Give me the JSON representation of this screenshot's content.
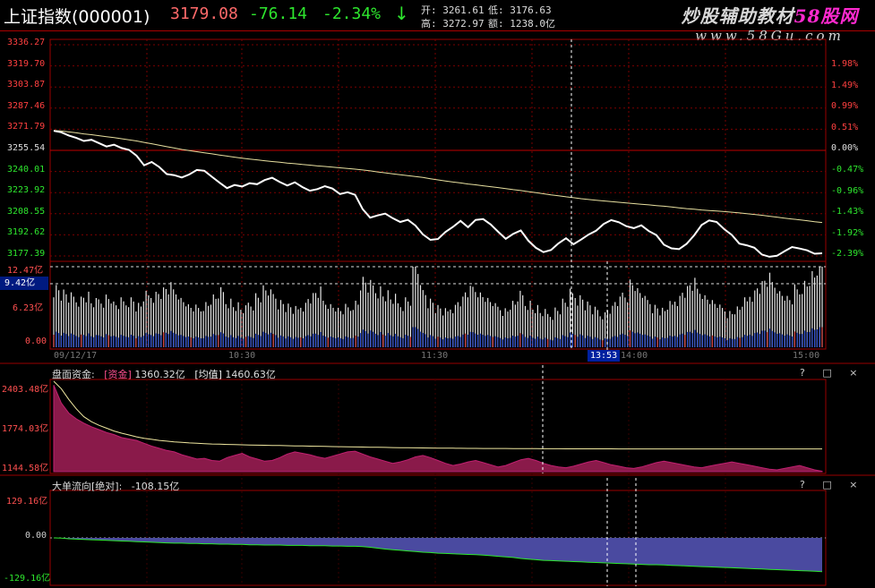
{
  "header": {
    "name": "上证指数(000001)",
    "price": "3179.08",
    "change": "-76.14",
    "pct": "-2.34%",
    "arrow": "↓",
    "open_label": "开:",
    "open": "3261.61",
    "low_label": "低:",
    "low": "3176.63",
    "high_label": "高:",
    "high": "3272.97",
    "amount_label": "额:",
    "amount": "1238.0亿"
  },
  "brand": {
    "title_a": "炒股辅助教材",
    "title_b": "58股网",
    "url": "www.58Gu.com"
  },
  "main": {
    "price_labels": [
      "3336.27",
      "3319.70",
      "3303.87",
      "3287.46",
      "3271.79",
      "3255.54",
      "3240.01",
      "3223.92",
      "3208.55",
      "3192.62",
      "3177.39"
    ],
    "pct_labels": [
      "1.98%",
      "1.49%",
      "0.99%",
      "0.51%",
      "0.00%",
      "-0.47%",
      "-0.96%",
      "-1.43%",
      "-1.92%",
      "-2.39%"
    ],
    "colors": {
      "up": "#ff4040",
      "down": "#2ee62e",
      "price_line": "#ffffff",
      "avg_line": "#e8e0a0",
      "grid": "#a00000"
    }
  },
  "volume": {
    "labels": [
      "12.47亿",
      "9.42亿",
      "6.23亿",
      "0.00"
    ],
    "time_labels": [
      "09/12/17",
      "10:30",
      "11:30",
      "14:00",
      "15:00"
    ],
    "cursor_time": "13:53"
  },
  "fund": {
    "title": "盘面资金:",
    "tag1": "[资金]",
    "val1": "1360.32亿",
    "tag2": "[均值]",
    "val2": "1460.63亿",
    "labels": [
      "2403.48亿",
      "1774.03亿",
      "1144.58亿"
    ],
    "controls": "? □ × "
  },
  "bigorder": {
    "title": "大单流向[绝对]:",
    "value": "-108.15亿",
    "labels": [
      "129.16亿",
      "0.00",
      "-129.16亿"
    ],
    "controls": "? □ × "
  },
  "series": {
    "price": [
      3271.5,
      3270.4,
      3268.0,
      3266.2,
      3263.9,
      3264.8,
      3262.3,
      3259.7,
      3261.1,
      3258.6,
      3257.2,
      3252.8,
      3245.6,
      3248.1,
      3244.3,
      3239.0,
      3238.2,
      3236.4,
      3238.7,
      3242.1,
      3241.5,
      3237.0,
      3232.5,
      3228.4,
      3230.8,
      3229.6,
      3232.1,
      3231.4,
      3234.5,
      3236.2,
      3233.0,
      3230.4,
      3232.8,
      3229.2,
      3226.5,
      3227.7,
      3229.9,
      3228.1,
      3224.0,
      3225.3,
      3223.4,
      3212.7,
      3206.2,
      3207.9,
      3209.2,
      3205.8,
      3203.0,
      3204.6,
      3200.3,
      3193.6,
      3189.5,
      3190.1,
      3195.4,
      3199.3,
      3203.8,
      3199.0,
      3204.5,
      3205.1,
      3201.1,
      3195.6,
      3190.3,
      3194.0,
      3196.6,
      3188.9,
      3183.5,
      3180.3,
      3181.8,
      3186.9,
      3190.7,
      3186.2,
      3189.7,
      3193.5,
      3196.4,
      3201.5,
      3204.4,
      3202.8,
      3199.8,
      3198.3,
      3200.4,
      3196.1,
      3193.1,
      3185.8,
      3183.1,
      3182.5,
      3186.5,
      3192.9,
      3200.7,
      3204.1,
      3203.0,
      3197.6,
      3193.2,
      3186.7,
      3185.4,
      3183.6,
      3178.5,
      3176.8,
      3177.5,
      3180.9,
      3184.1,
      3183.0,
      3181.6,
      3179.1,
      3179.4
    ],
    "avg": [
      3271.8,
      3271.4,
      3270.7,
      3270.0,
      3269.2,
      3268.6,
      3267.9,
      3267.1,
      3266.4,
      3265.6,
      3264.8,
      3263.9,
      3262.8,
      3261.8,
      3260.7,
      3259.6,
      3258.6,
      3257.5,
      3256.6,
      3255.8,
      3255.0,
      3254.2,
      3253.3,
      3252.5,
      3251.7,
      3251.0,
      3250.3,
      3249.7,
      3249.0,
      3248.4,
      3247.9,
      3247.3,
      3246.8,
      3246.2,
      3245.7,
      3245.1,
      3244.7,
      3244.2,
      3243.7,
      3243.2,
      3242.7,
      3242.1,
      3241.4,
      3240.6,
      3239.9,
      3239.2,
      3238.5,
      3237.8,
      3237.1,
      3236.4,
      3235.5,
      3234.6,
      3233.8,
      3233.0,
      3232.3,
      3231.5,
      3230.9,
      3230.2,
      3229.5,
      3228.8,
      3228.1,
      3227.3,
      3226.6,
      3225.8,
      3225.0,
      3224.2,
      3223.4,
      3222.7,
      3221.9,
      3221.2,
      3220.5,
      3219.9,
      3219.3,
      3218.8,
      3218.3,
      3217.8,
      3217.3,
      3216.8,
      3216.3,
      3215.8,
      3215.3,
      3214.8,
      3214.2,
      3213.6,
      3213.0,
      3212.5,
      3212.0,
      3211.6,
      3211.2,
      3210.8,
      3210.3,
      3209.8,
      3209.2,
      3208.6,
      3208.0,
      3207.3,
      3206.6,
      3205.9,
      3205.2,
      3204.6,
      3203.9,
      3203.2,
      3202.6
    ],
    "volume": [
      9.1,
      8.2,
      7.6,
      7.4,
      7.9,
      6.8,
      7.2,
      7.7,
      6.5,
      6.9,
      7.3,
      6.3,
      7.8,
      8.1,
      8.5,
      9.0,
      8.7,
      7.2,
      6.1,
      5.9,
      6.6,
      7.5,
      8.3,
      7.1,
      6.4,
      5.8,
      6.7,
      7.9,
      8.8,
      8.0,
      6.9,
      6.2,
      5.7,
      6.5,
      7.7,
      8.4,
      7.0,
      6.3,
      5.6,
      6.0,
      6.8,
      10.0,
      9.3,
      8.9,
      8.1,
      7.4,
      6.6,
      7.3,
      12.47,
      8.6,
      7.1,
      6.0,
      5.4,
      6.2,
      7.2,
      8.5,
      9.1,
      8.0,
      7.0,
      6.1,
      5.7,
      6.6,
      7.8,
      6.8,
      6.0,
      5.3,
      5.0,
      5.8,
      6.9,
      8.1,
      7.6,
      6.5,
      5.6,
      5.1,
      5.9,
      7.0,
      8.2,
      9.9,
      8.4,
      7.1,
      6.2,
      5.6,
      6.4,
      7.5,
      8.7,
      9.6,
      8.8,
      7.6,
      6.7,
      5.9,
      5.3,
      5.8,
      6.9,
      8.3,
      9.4,
      10.3,
      9.8,
      8.2,
      7.3,
      8.7,
      9.7,
      10.8,
      12.2
    ],
    "fund": [
      2350,
      2100,
      1960,
      1880,
      1820,
      1770,
      1730,
      1690,
      1660,
      1620,
      1600,
      1580,
      1540,
      1500,
      1470,
      1440,
      1420,
      1380,
      1350,
      1320,
      1330,
      1300,
      1290,
      1340,
      1370,
      1400,
      1350,
      1320,
      1290,
      1300,
      1340,
      1390,
      1420,
      1400,
      1380,
      1350,
      1330,
      1360,
      1390,
      1420,
      1430,
      1390,
      1350,
      1320,
      1290,
      1260,
      1280,
      1310,
      1350,
      1370,
      1340,
      1300,
      1260,
      1230,
      1250,
      1280,
      1300,
      1270,
      1240,
      1210,
      1230,
      1270,
      1310,
      1330,
      1300,
      1260,
      1230,
      1210,
      1200,
      1220,
      1250,
      1280,
      1300,
      1270,
      1240,
      1220,
      1200,
      1190,
      1210,
      1240,
      1270,
      1290,
      1270,
      1250,
      1230,
      1210,
      1200,
      1220,
      1240,
      1260,
      1280,
      1260,
      1240,
      1220,
      1200,
      1180,
      1170,
      1190,
      1210,
      1230,
      1200,
      1170,
      1150
    ],
    "fund_avg": [
      2403,
      2300,
      2150,
      2020,
      1910,
      1840,
      1790,
      1750,
      1710,
      1680,
      1655,
      1630,
      1610,
      1595,
      1580,
      1570,
      1560,
      1552,
      1545,
      1540,
      1535,
      1530,
      1527,
      1524,
      1521,
      1518,
      1516,
      1514,
      1512,
      1510,
      1508,
      1506,
      1504,
      1502,
      1500,
      1498,
      1496,
      1494,
      1492,
      1490,
      1489,
      1487,
      1485,
      1484,
      1482,
      1480,
      1479,
      1478,
      1476,
      1475,
      1474,
      1473,
      1472,
      1471,
      1470,
      1469,
      1469,
      1468,
      1468,
      1467,
      1467,
      1466,
      1466,
      1465,
      1465,
      1464,
      1464,
      1464,
      1463,
      1463,
      1463,
      1462,
      1462,
      1462,
      1462,
      1461,
      1461,
      1461,
      1461,
      1461,
      1461,
      1461,
      1461,
      1461,
      1461,
      1461,
      1461,
      1461,
      1461,
      1461,
      1461,
      1461,
      1461,
      1461,
      1461,
      1461,
      1461,
      1461,
      1461,
      1461,
      1461,
      1461,
      1460.63
    ],
    "bigorder": [
      0,
      -1,
      -3,
      -4,
      -5,
      -6,
      -7,
      -8,
      -9,
      -10,
      -11,
      -12,
      -13,
      -14,
      -15,
      -16,
      -17,
      -17,
      -18,
      -18,
      -19,
      -19,
      -20,
      -20,
      -21,
      -21,
      -22,
      -22,
      -23,
      -23,
      -23,
      -24,
      -24,
      -24,
      -25,
      -25,
      -25,
      -26,
      -26,
      -27,
      -27,
      -28,
      -30,
      -33,
      -36,
      -38,
      -40,
      -42,
      -44,
      -46,
      -47,
      -49,
      -50,
      -51,
      -52,
      -53,
      -54,
      -55,
      -57,
      -59,
      -61,
      -63,
      -66,
      -68,
      -70,
      -72,
      -73,
      -74,
      -75,
      -76,
      -77,
      -78,
      -79,
      -80,
      -81,
      -82,
      -83,
      -84,
      -85,
      -86,
      -86,
      -87,
      -88,
      -89,
      -90,
      -91,
      -92,
      -93,
      -94,
      -95,
      -96,
      -97,
      -98,
      -99,
      -100,
      -101,
      -102,
      -103,
      -104,
      -105,
      -106,
      -107,
      -108.15
    ]
  }
}
